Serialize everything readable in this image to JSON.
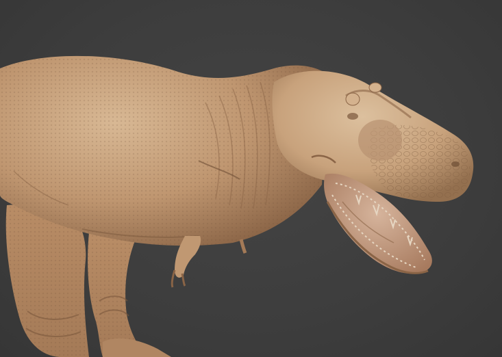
{
  "scene": {
    "subject": "t-rex-sculpt",
    "colors": {
      "background": "#3d3d3d",
      "skin_light": "#d2b08c",
      "skin_mid": "#b38a64",
      "skin_dark": "#7a573c",
      "mouth_inner": "#c49a80",
      "teeth": "#e6d6c2"
    }
  }
}
